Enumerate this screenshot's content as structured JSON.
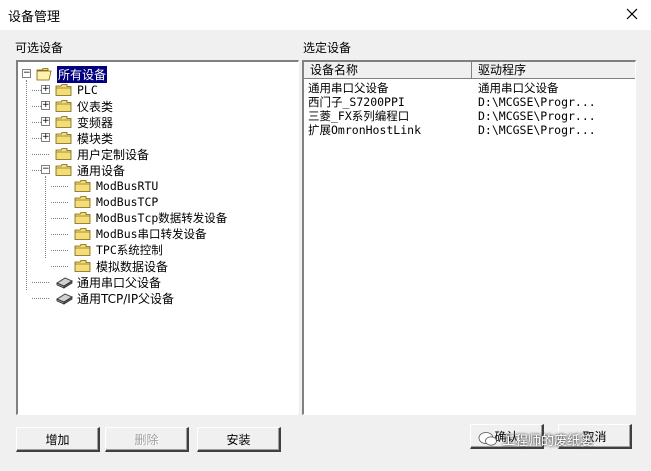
{
  "window": {
    "title": "设备管理"
  },
  "available": {
    "label": "可选设备",
    "tree": [
      {
        "label": "所有设备",
        "icon": "folder-open-icon",
        "expander": "−"
      },
      {
        "label": "PLC",
        "icon": "folder-icon",
        "expander": "+"
      },
      {
        "label": "仪表类",
        "icon": "folder-icon",
        "expander": "+"
      },
      {
        "label": "变频器",
        "icon": "folder-icon",
        "expander": "+"
      },
      {
        "label": "模块类",
        "icon": "folder-icon",
        "expander": "+"
      },
      {
        "label": "用户定制设备",
        "icon": "folder-icon"
      },
      {
        "label": "通用设备",
        "icon": "folder-icon",
        "expander": "−"
      },
      {
        "label": "ModBusRTU",
        "icon": "folder-icon"
      },
      {
        "label": "ModBusTCP",
        "icon": "folder-icon"
      },
      {
        "label": "ModBusTcp数据转发设备",
        "icon": "folder-icon"
      },
      {
        "label": "ModBus串口转发设备",
        "icon": "folder-icon"
      },
      {
        "label": "TPC系统控制",
        "icon": "folder-icon"
      },
      {
        "label": "模拟数据设备",
        "icon": "folder-icon"
      },
      {
        "label": "通用串口父设备",
        "icon": "device-icon"
      },
      {
        "label": "通用TCP/IP父设备",
        "icon": "device-icon"
      }
    ]
  },
  "selected": {
    "label": "选定设备",
    "columns": [
      "设备名称",
      "驱动程序"
    ],
    "rows": [
      [
        "通用串口父设备",
        "通用串口父设备"
      ],
      [
        "西门子_S7200PPI",
        "D:\\MCGSE\\Progr..."
      ],
      [
        "三菱_FX系列编程口",
        "D:\\MCGSE\\Progr..."
      ],
      [
        "扩展OmronHostLink",
        "D:\\MCGSE\\Progr..."
      ]
    ]
  },
  "buttons": {
    "add": "增加",
    "delete": "删除",
    "install": "安装",
    "ok": "确认",
    "cancel": "取消"
  },
  "watermark": "工程师的废纸篓"
}
